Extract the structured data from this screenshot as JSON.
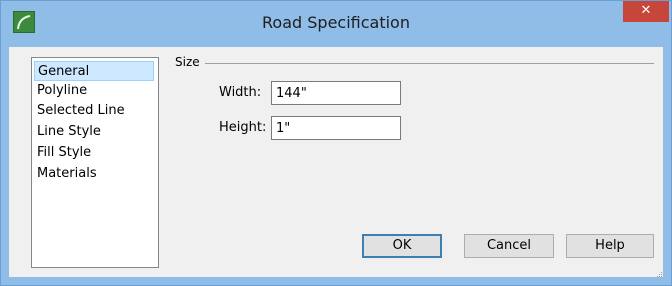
{
  "window": {
    "title": "Road Specification",
    "close_label": "✕"
  },
  "categories": {
    "items": [
      "General",
      "Polyline",
      "Selected Line",
      "Line Style",
      "Fill Style",
      "Materials"
    ],
    "selected": "General"
  },
  "size_group": {
    "label": "Size",
    "width_label": "Width:",
    "width_value": "144\"",
    "height_label": "Height:",
    "height_value": "1\""
  },
  "buttons": {
    "ok": "OK",
    "cancel": "Cancel",
    "help": "Help"
  },
  "colors": {
    "titlebar": "#8fbde8",
    "close": "#c7463c",
    "selection": "#cde8ff"
  },
  "icons": {
    "app": "app-logo-icon",
    "close": "close-icon",
    "resize": "resize-grip-icon"
  }
}
